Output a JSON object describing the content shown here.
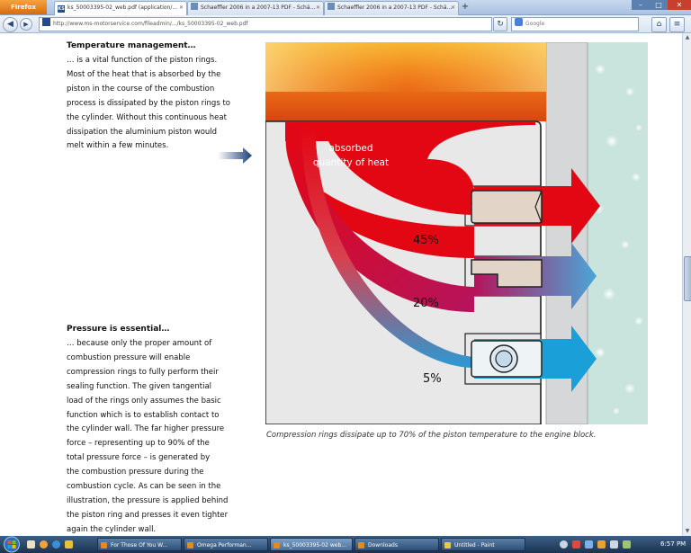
{
  "browser": {
    "menu_button": "Firefox",
    "tabs": [
      {
        "favicon": "KS",
        "label": "ks_50003395-02_web.pdf (application/...",
        "active": true
      },
      {
        "favicon": "",
        "label": "Schaeffler 2006 in a 2007-13 PDF - Schä...",
        "active": false
      },
      {
        "favicon": "",
        "label": "Schaeffler 2006 in a 2007-13 PDF - Schä...",
        "active": false
      }
    ],
    "new_tab": "+",
    "url": "http://www.ms-motorservice.com/fileadmin/.../ks_50003395-02_web.pdf",
    "search_placeholder": "Google",
    "window_controls": [
      "–",
      "□",
      "✕"
    ]
  },
  "article": {
    "section1": {
      "title": "Temperature management…",
      "lines": [
        "… is a vital function of the piston rings.",
        "Most of the heat that is absorbed by the",
        "piston in the course of the combustion",
        "process is dissipated by the piston rings to",
        "the cylinder. Without this continuous heat",
        "dissipation the aluminium piston would",
        "melt within a few minutes."
      ]
    },
    "section2": {
      "title": "Pressure is essential…",
      "lines": [
        "… because only the proper amount of",
        "combustion pressure will enable",
        "compression rings to fully perform their",
        "sealing function. The given tangential",
        "load of the rings only assumes the basic",
        "function which is to establish contact to",
        "the cylinder wall. The far higher pressure",
        "force – representing up to 90% of the",
        "total pressure force – is generated by",
        "the combustion pressure during the",
        "combustion cycle. As can be seen in the",
        "illustration, the pressure is applied behind",
        "the piston ring and presses it even tighter",
        "again the cylinder wall."
      ]
    }
  },
  "figure": {
    "label_line1": "absorbed",
    "label_line2": "quantity of heat",
    "pct_ring1": "45%",
    "pct_ring2": "20%",
    "pct_ring3": "5%",
    "caption": "Compression rings dissipate up to 70% of the piston temperature to the engine block.",
    "colors": {
      "heat": "#e30613",
      "magenta": "#b5145c",
      "blue": "#1a9fd9",
      "piston": "#e9e9e9",
      "cylinder": "#d4d6d8",
      "coolant": "#c7e2dc"
    }
  },
  "taskbar": {
    "items": [
      {
        "label": "For Those Of You W...",
        "active": false
      },
      {
        "label": "Omega Performan...",
        "active": false
      },
      {
        "label": "ks_50003395-02 web...",
        "active": true
      },
      {
        "label": "Downloads",
        "active": false
      },
      {
        "label": "Untitled - Paint",
        "active": false
      }
    ],
    "clock": "6:57 PM"
  }
}
